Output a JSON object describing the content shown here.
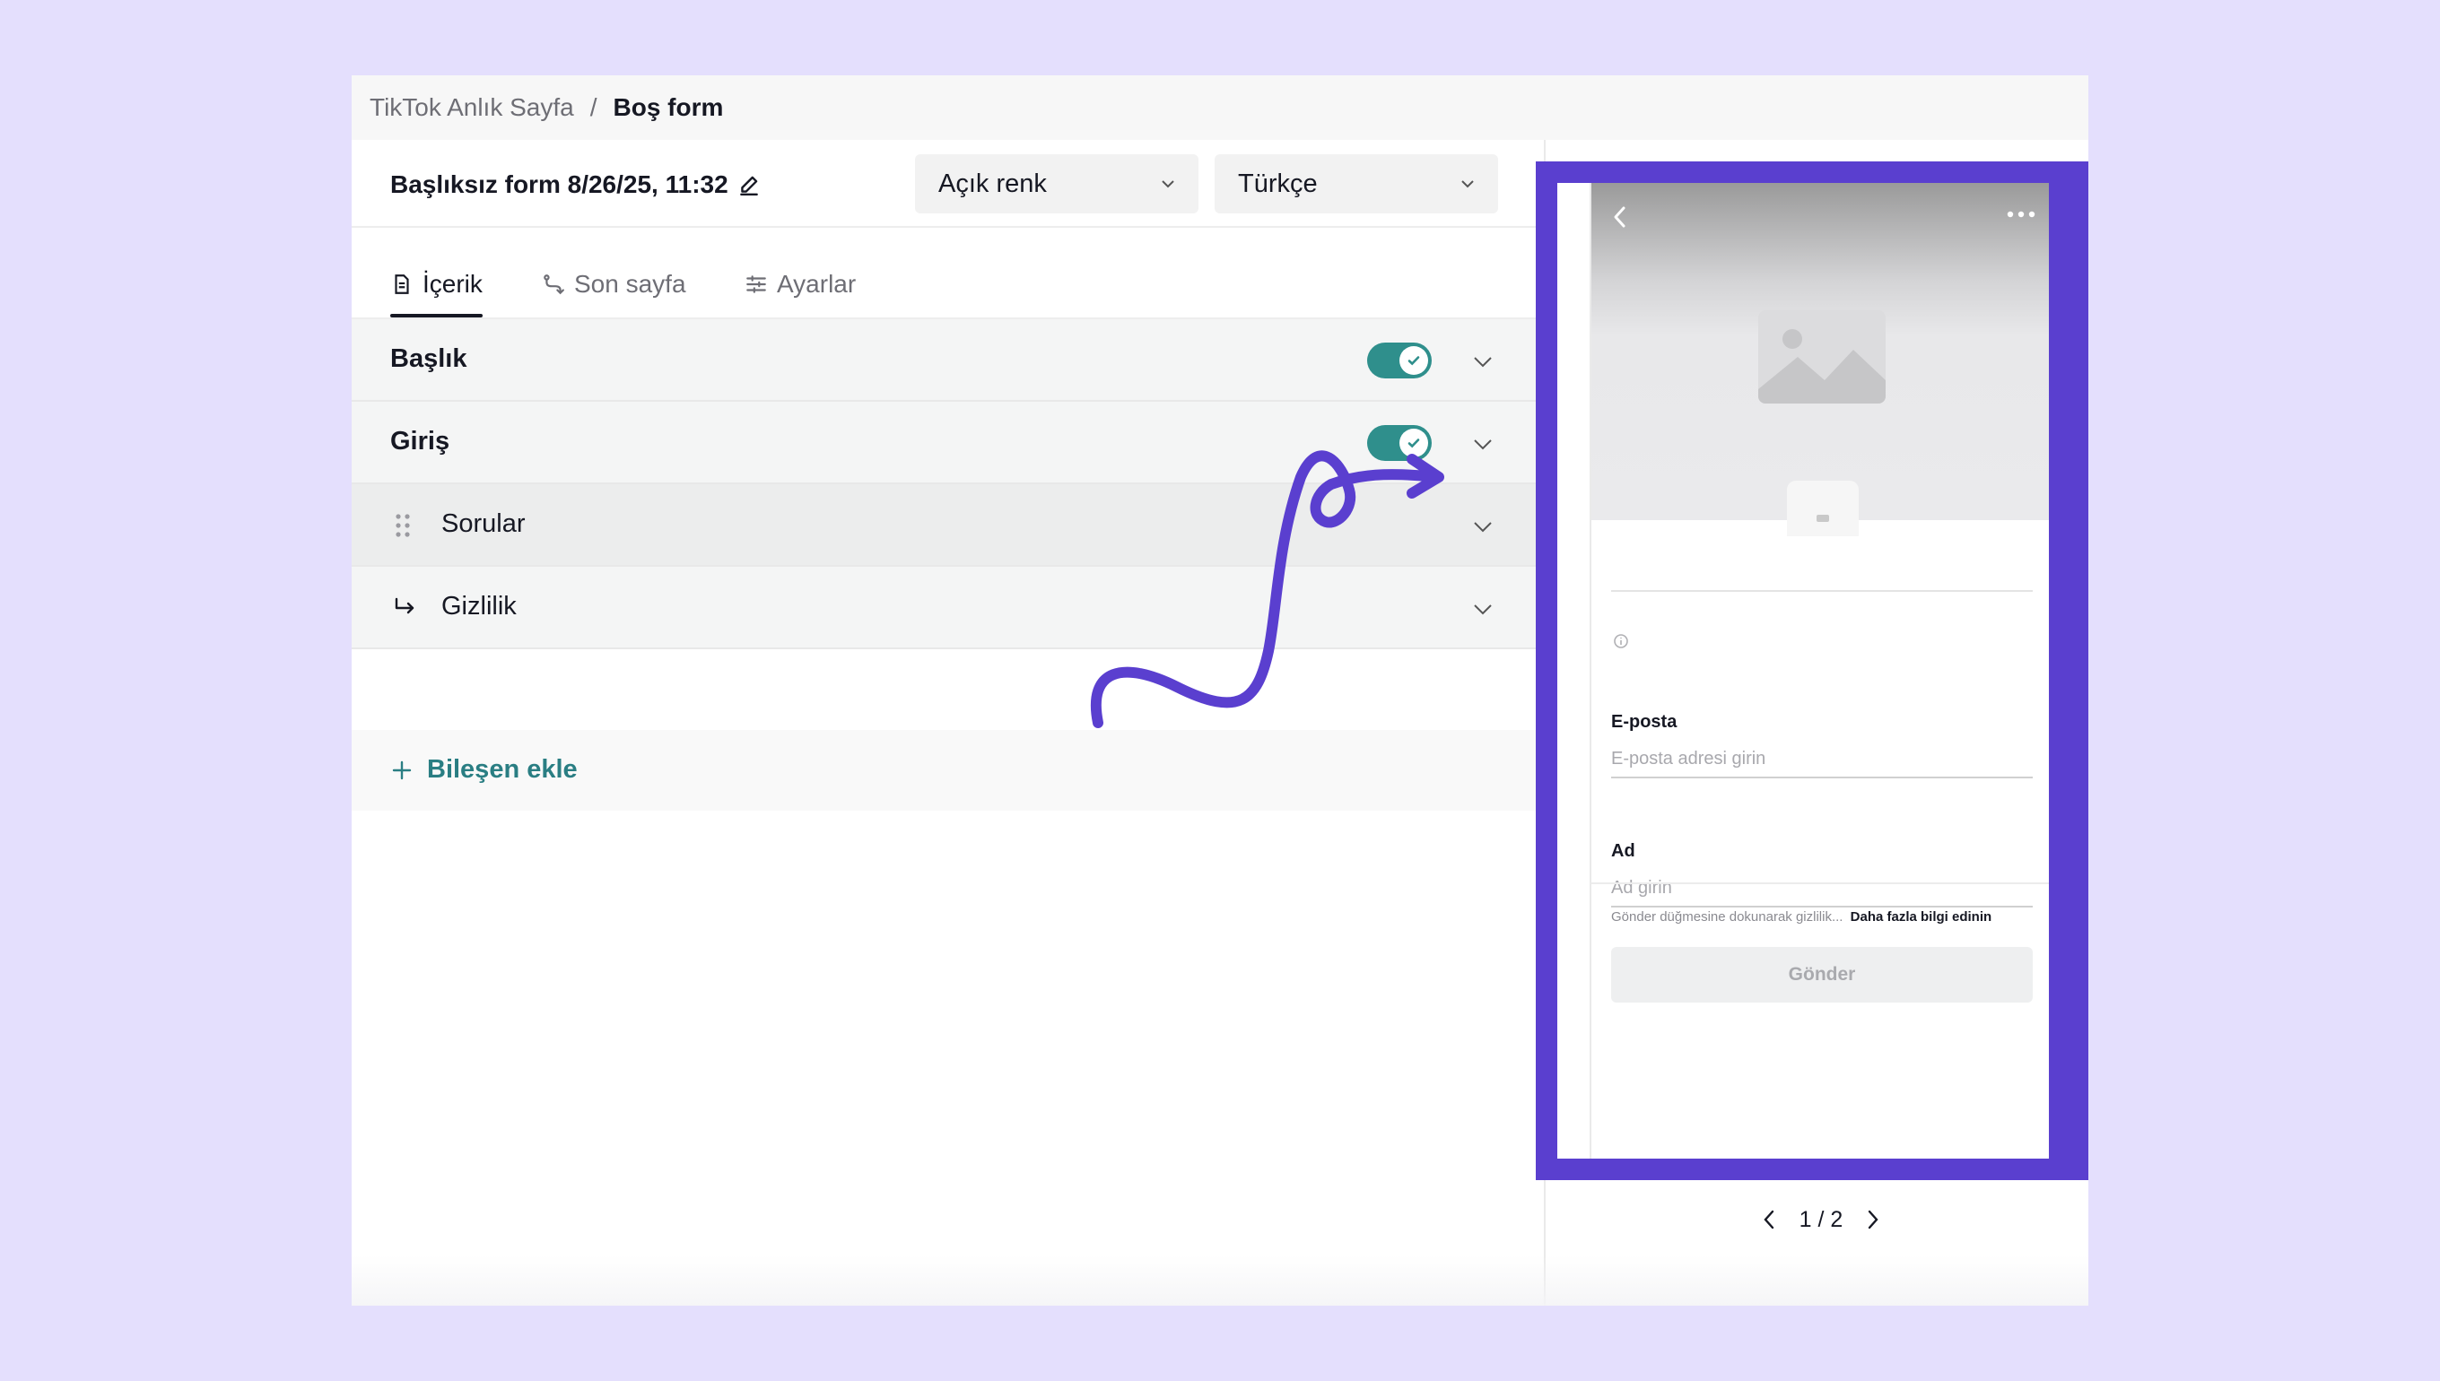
{
  "breadcrumb": {
    "parent": "TikTok Anlık Sayfa",
    "separator": "/",
    "current": "Boş form"
  },
  "form": {
    "title": "Başlıksız form 8/26/25, 11:32"
  },
  "selects": {
    "theme": "Açık renk",
    "language": "Türkçe"
  },
  "tabs": [
    {
      "label": "İçerik",
      "active": true
    },
    {
      "label": "Son sayfa",
      "active": false
    },
    {
      "label": "Ayarlar",
      "active": false
    }
  ],
  "sections": [
    {
      "label": "Başlık",
      "toggle": true
    },
    {
      "label": "Giriş",
      "toggle": true
    },
    {
      "label": "Sorular",
      "toggle": false
    },
    {
      "label": "Gizlilik",
      "toggle": false
    }
  ],
  "add_component": "Bileşen ekle",
  "preview": {
    "fields": [
      {
        "label": "E-posta",
        "placeholder": "E-posta adresi girin"
      },
      {
        "label": "Ad",
        "placeholder": "Ad girin"
      }
    ],
    "consent_text": "Gönder düğmesine dokunarak gizlilik...",
    "consent_link": "Daha fazla bilgi edinin",
    "submit": "Gönder"
  },
  "pager": {
    "text": "1 / 2",
    "current": 1,
    "total": 2
  },
  "colors": {
    "accent": "#2f8f8c",
    "highlight": "#5a3fcf",
    "background": "#e4dffd"
  }
}
